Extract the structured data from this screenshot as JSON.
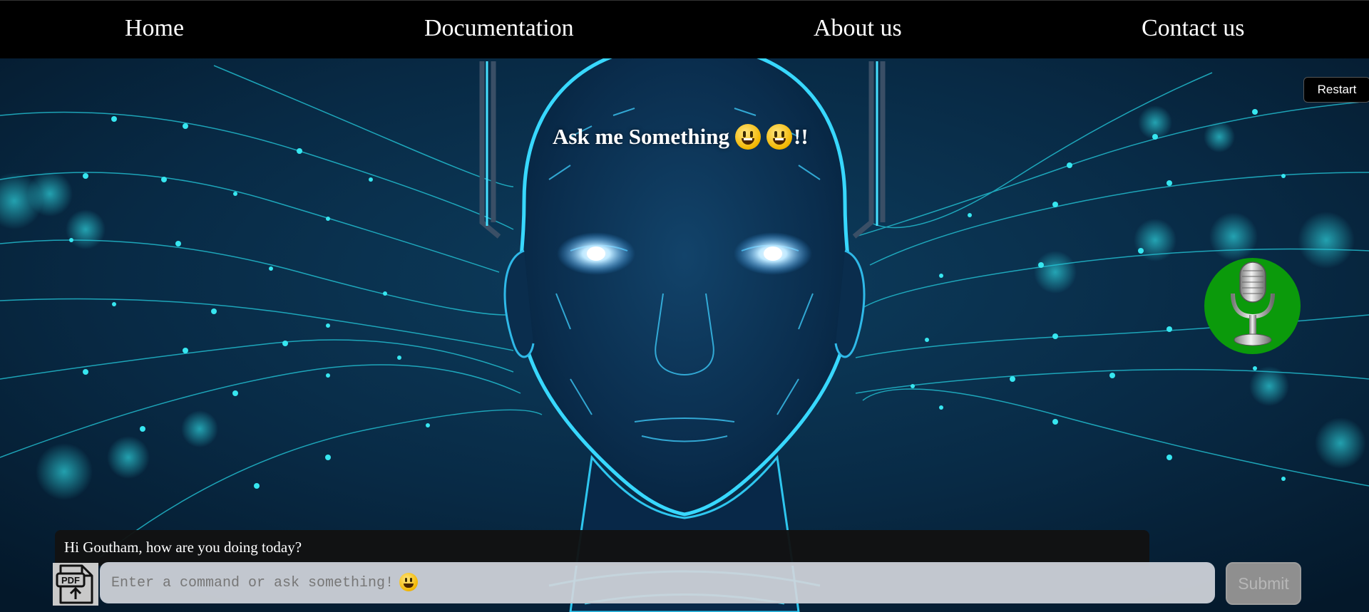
{
  "nav": {
    "items": [
      {
        "label": "Home"
      },
      {
        "label": "Documentation"
      },
      {
        "label": "About us"
      },
      {
        "label": "Contact us"
      }
    ]
  },
  "hero": {
    "title": "Ask me Something",
    "title_suffix": "!!",
    "emojis": [
      "grinning-face-emoji",
      "grinning-face-emoji"
    ]
  },
  "toolbar": {
    "restart_label": "Restart",
    "mic_icon": "microphone-icon"
  },
  "chat": {
    "response": "Hi Goutham, how are you doing today?"
  },
  "input": {
    "placeholder": "Enter a command or ask something! ",
    "upload_icon": "pdf-upload-icon",
    "submit_label": "Submit"
  },
  "colors": {
    "nav_bg": "#000000",
    "mic_bg": "#0b9a0b",
    "accent_glow": "#19d6e6",
    "chat_bg": "#121212",
    "submit_bg": "#8f8f8f"
  }
}
